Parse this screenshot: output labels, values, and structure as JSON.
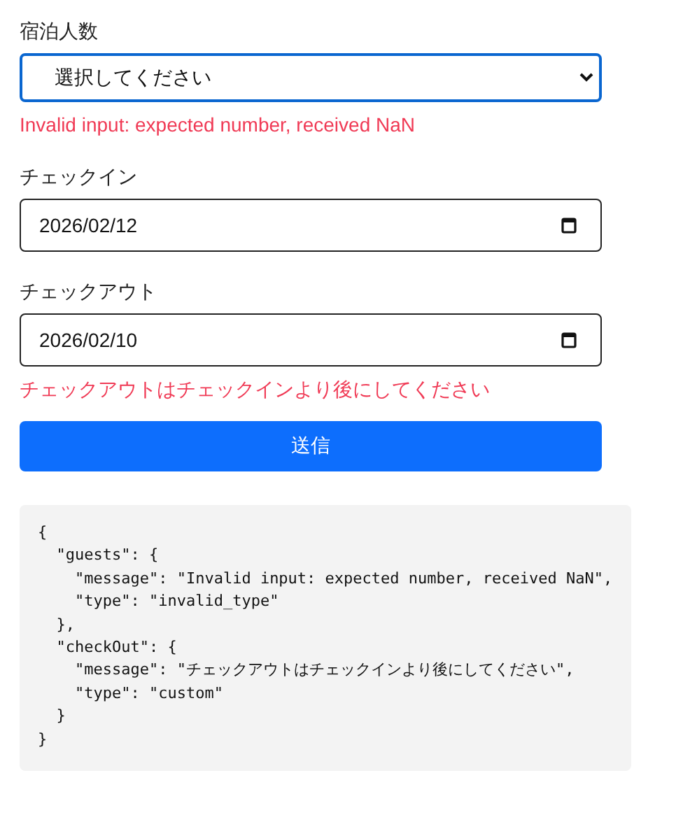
{
  "fields": [
    {
      "kind": "select",
      "label": "宿泊人数",
      "value": "選択してください",
      "focused": true,
      "error": "Invalid input: expected number, received NaN"
    },
    {
      "kind": "date",
      "label": "チェックイン",
      "value": "2026/02/12",
      "focused": false
    },
    {
      "kind": "date",
      "label": "チェックアウト",
      "value": "2026/02/10",
      "focused": false,
      "error": "チェックアウトはチェックインより後にしてください"
    }
  ],
  "submit_button": "送信",
  "code_output": [
    "{",
    "  \"guests\": {",
    "    \"message\": \"Invalid input: expected number, received NaN\",",
    "    \"type\": \"invalid_type\"",
    "  },",
    "  \"checkOut\": {",
    "    \"message\": \"チェックアウトはチェックインより後にしてください\",",
    "    \"type\": \"custom\"",
    "  }",
    "}"
  ]
}
